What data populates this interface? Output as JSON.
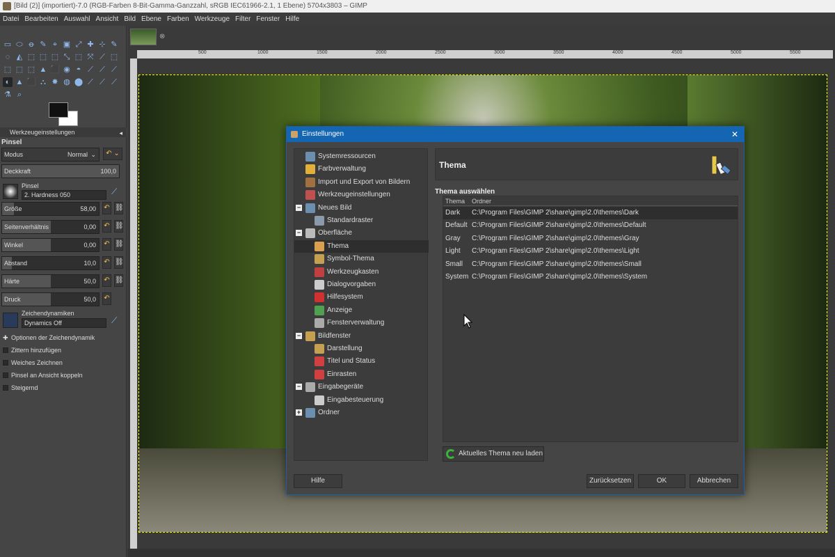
{
  "window": {
    "title": "[Bild (2)] (importiert)-7.0 (RGB-Farben 8-Bit-Gamma-Ganzzahl, sRGB IEC61966-2.1, 1 Ebene) 5704x3803 – GIMP"
  },
  "menu": [
    "Datei",
    "Bearbeiten",
    "Auswahl",
    "Ansicht",
    "Bild",
    "Ebene",
    "Farben",
    "Werkzeuge",
    "Filter",
    "Fenster",
    "Hilfe"
  ],
  "toolbox": {
    "tab_label": "Werkzeugeinstellungen",
    "tool_title": "Pinsel",
    "modus_label": "Modus",
    "modus_value": "Normal",
    "deckkraft": {
      "label": "Deckkraft",
      "value": "100,0"
    },
    "pinsel_label": "Pinsel",
    "brush_name": "2. Hardness 050",
    "sliders": [
      {
        "label": "Größe",
        "value": "58,00"
      },
      {
        "label": "Seitenverhältnis",
        "value": "0,00"
      },
      {
        "label": "Winkel",
        "value": "0,00"
      },
      {
        "label": "Abstand",
        "value": "10,0"
      },
      {
        "label": "Härte",
        "value": "50,0"
      },
      {
        "label": "Druck",
        "value": "50,0"
      }
    ],
    "dynamics_label": "Zeichendynamiken",
    "dynamics_value": "Dynamics Off",
    "options": [
      "Optionen der Zeichendynamik",
      "Zittern hinzufügen",
      "Weiches Zeichnen",
      "Pinsel an Ansicht koppeln",
      "Steigernd"
    ]
  },
  "ruler_ticks": [
    "500",
    "1000",
    "1500",
    "2000",
    "2500",
    "3000",
    "3500",
    "4000",
    "4500",
    "5000",
    "5500"
  ],
  "dialog": {
    "title": "Einstellungen",
    "tree": [
      {
        "label": "Systemressourcen",
        "level": 1,
        "icon_color": "#6c8fb0"
      },
      {
        "label": "Farbverwaltung",
        "level": 1,
        "icon_color": "#e0b03a"
      },
      {
        "label": "Import und Export von Bildern",
        "level": 1,
        "icon_color": "#a07040"
      },
      {
        "label": "Werkzeugeinstellungen",
        "level": 1,
        "icon_color": "#c05050"
      },
      {
        "label": "Neues Bild",
        "level": 1,
        "expander": "−",
        "icon_color": "#6c8fb0"
      },
      {
        "label": "Standardraster",
        "level": 2,
        "icon_color": "#8a9aaa"
      },
      {
        "label": "Oberfläche",
        "level": 1,
        "expander": "−",
        "icon_color": "#bbbbbb"
      },
      {
        "label": "Thema",
        "level": 2,
        "selected": true,
        "icon_color": "#d9a050"
      },
      {
        "label": "Symbol-Thema",
        "level": 2,
        "icon_color": "#c4a050"
      },
      {
        "label": "Werkzeugkasten",
        "level": 2,
        "icon_color": "#c04040"
      },
      {
        "label": "Dialogvorgaben",
        "level": 2,
        "icon_color": "#cccccc"
      },
      {
        "label": "Hilfesystem",
        "level": 2,
        "icon_color": "#d03030"
      },
      {
        "label": "Anzeige",
        "level": 2,
        "icon_color": "#50a050"
      },
      {
        "label": "Fensterverwaltung",
        "level": 2,
        "icon_color": "#aaaaaa"
      },
      {
        "label": "Bildfenster",
        "level": 1,
        "expander": "−",
        "icon_color": "#c4a050"
      },
      {
        "label": "Darstellung",
        "level": 2,
        "icon_color": "#c4a050"
      },
      {
        "label": "Titel und Status",
        "level": 2,
        "icon_color": "#d04040"
      },
      {
        "label": "Einrasten",
        "level": 2,
        "icon_color": "#d04040"
      },
      {
        "label": "Eingabegeräte",
        "level": 1,
        "expander": "−",
        "icon_color": "#aaaaaa"
      },
      {
        "label": "Eingabesteuerung",
        "level": 2,
        "icon_color": "#cccccc"
      },
      {
        "label": "Ordner",
        "level": 1,
        "expander": "+",
        "icon_color": "#6c8fb0"
      }
    ],
    "section_title": "Thema",
    "select_label": "Thema auswählen",
    "columns": {
      "theme": "Thema",
      "folder": "Ordner"
    },
    "themes": [
      {
        "name": "Dark",
        "path": "C:\\Program Files\\GIMP 2\\share\\gimp\\2.0\\themes\\Dark",
        "selected": true
      },
      {
        "name": "Default",
        "path": "C:\\Program Files\\GIMP 2\\share\\gimp\\2.0\\themes\\Default"
      },
      {
        "name": "Gray",
        "path": "C:\\Program Files\\GIMP 2\\share\\gimp\\2.0\\themes\\Gray"
      },
      {
        "name": "Light",
        "path": "C:\\Program Files\\GIMP 2\\share\\gimp\\2.0\\themes\\Light"
      },
      {
        "name": "Small",
        "path": "C:\\Program Files\\GIMP 2\\share\\gimp\\2.0\\themes\\Small"
      },
      {
        "name": "System",
        "path": "C:\\Program Files\\GIMP 2\\share\\gimp\\2.0\\themes\\System"
      }
    ],
    "reload_label": "Aktuelles Thema neu laden",
    "buttons": {
      "help": "Hilfe",
      "reset": "Zurücksetzen",
      "ok": "OK",
      "cancel": "Abbrechen"
    }
  },
  "colors": {
    "dialog_titlebar": "#1466b3",
    "reload_icon": "#3db33d"
  }
}
